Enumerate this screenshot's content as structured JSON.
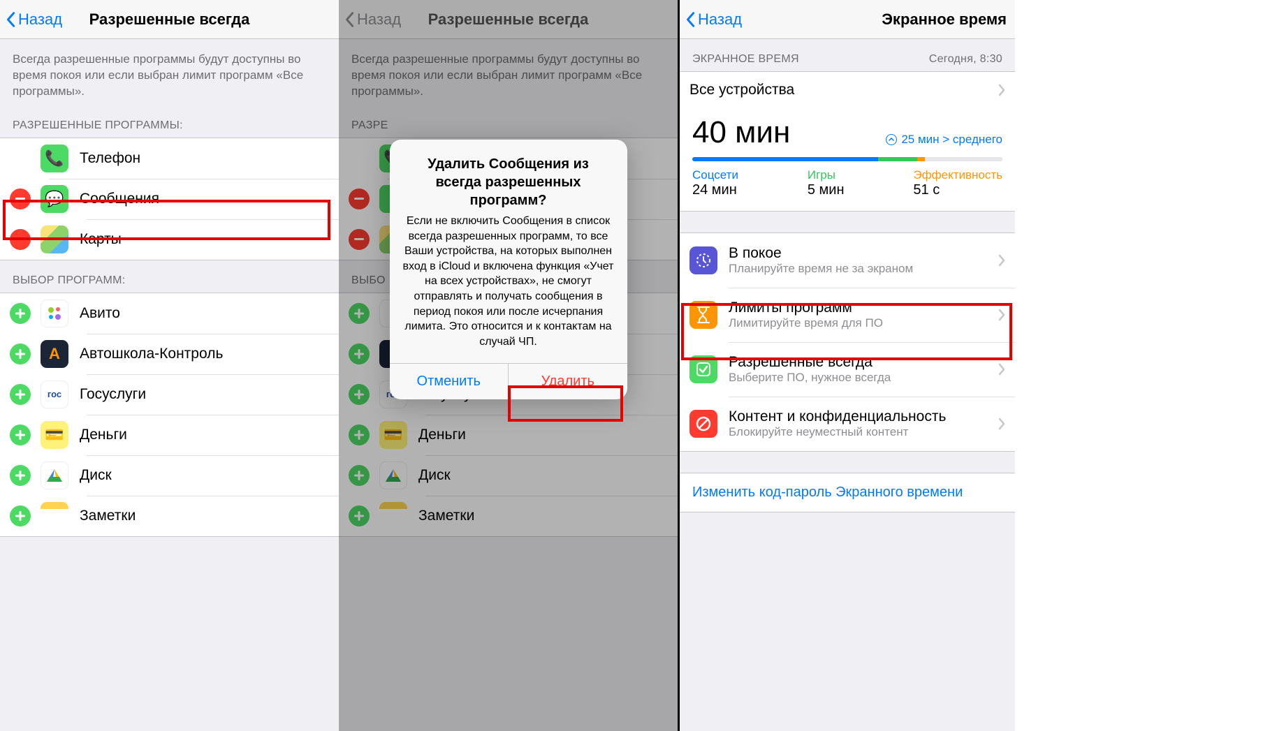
{
  "pane1": {
    "back": "Назад",
    "title": "Разрешенные всегда",
    "desc": "Всегда разрешенные программы будут доступны во время покоя или если выбран лимит программ «Все программы».",
    "allowed_header": "РАЗРЕШЕННЫЕ ПРОГРАММЫ:",
    "allowed": [
      {
        "name": "Телефон",
        "icon": "phone",
        "editable": false
      },
      {
        "name": "Сообщения",
        "icon": "messages",
        "editable": true
      },
      {
        "name": "Карты",
        "icon": "maps",
        "editable": true
      }
    ],
    "choose_header": "ВЫБОР ПРОГРАММ:",
    "choose": [
      {
        "name": "Авито",
        "icon": "avito"
      },
      {
        "name": "Автошкола-Контроль",
        "icon": "school"
      },
      {
        "name": "Госуслуги",
        "icon": "gos"
      },
      {
        "name": "Деньги",
        "icon": "money"
      },
      {
        "name": "Диск",
        "icon": "disk"
      },
      {
        "name": "Заметки",
        "icon": "notes"
      }
    ]
  },
  "pane2": {
    "back": "Назад",
    "title": "Разрешенные всегда",
    "desc": "Всегда разрешенные программы будут доступны во время покоя или если выбран лимит программ «Все программы».",
    "allowed_header": "РАЗРЕ",
    "choose_header": "ВЫБО",
    "choose": [
      {
        "name": "Госуслуги",
        "icon": "gos"
      },
      {
        "name": "Деньги",
        "icon": "money"
      },
      {
        "name": "Диск",
        "icon": "disk"
      },
      {
        "name": "Заметки",
        "icon": "notes"
      }
    ],
    "alert": {
      "title": "Удалить Сообщения из всегда разрешенных программ?",
      "body": "Если не включить Сообщения в список всегда разрешенных программ, то все Ваши устройства, на которых выполнен вход в iCloud и включена функция «Учет на всех устройствах», не смогут отправлять и получать сообщения в период покоя или после исчерпания лимита. Это относится и к контактам на случай ЧП.",
      "cancel": "Отменить",
      "confirm": "Удалить"
    }
  },
  "pane3": {
    "back": "Назад",
    "title": "Экранное время",
    "section_header": "ЭКРАННОЕ ВРЕМЯ",
    "timestamp": "Сегодня, 8:30",
    "devices": "Все устройства",
    "total": "40 мин",
    "delta": "25 мин > среднего",
    "categories": [
      {
        "label": "Соцсети",
        "value": "24 мин",
        "color": "#007aff"
      },
      {
        "label": "Игры",
        "value": "5 мин",
        "color": "#34c759"
      },
      {
        "label": "Эффективность",
        "value": "51 с",
        "color": "#ff9500"
      }
    ],
    "features": [
      {
        "title": "В покое",
        "sub": "Планируйте время не за экраном",
        "icon": "rest"
      },
      {
        "title": "Лимиты программ",
        "sub": "Лимитируйте время для ПО",
        "icon": "limit"
      },
      {
        "title": "Разрешенные всегда",
        "sub": "Выберите ПО, нужное всегда",
        "icon": "allow"
      },
      {
        "title": "Контент и конфиденциальность",
        "sub": "Блокируйте неуместный контент",
        "icon": "priv"
      }
    ],
    "link": "Изменить код-пароль Экранного времени"
  },
  "icons": {
    "phone": "📞",
    "messages": "💬",
    "maps": "",
    "avito": "",
    "school": "A",
    "gos": "гос",
    "money": "💳",
    "disk": "▲",
    "notes": "",
    "rest": "⏾",
    "limit": "⏳",
    "allow": "✓",
    "priv": "⊘"
  }
}
